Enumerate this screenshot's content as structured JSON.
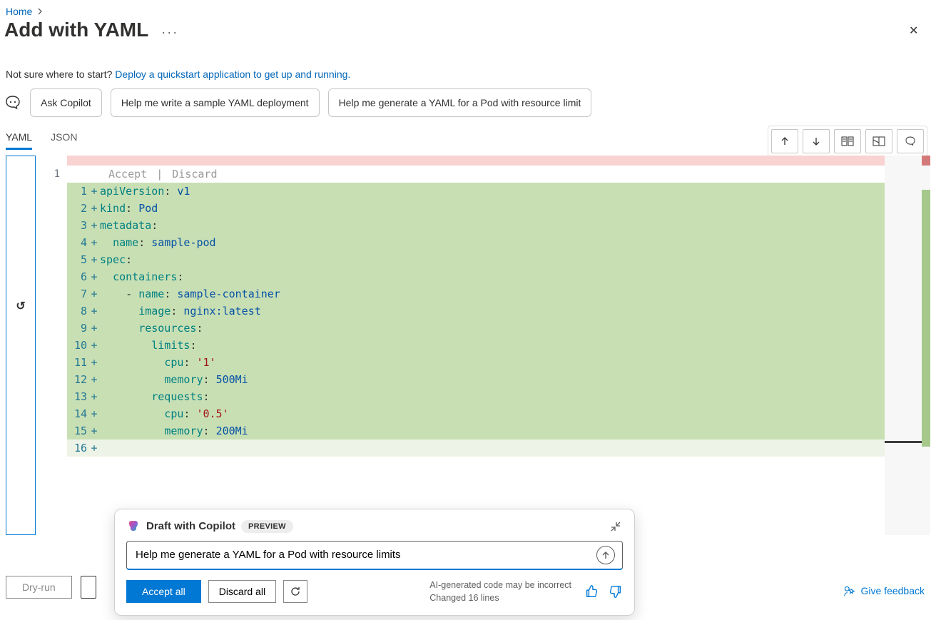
{
  "breadcrumb": {
    "home": "Home"
  },
  "title": "Add with YAML",
  "hint": {
    "lead": "Not sure where to start? ",
    "link": "Deploy a quickstart application to get up and running."
  },
  "suggestions": {
    "ask": "Ask Copilot",
    "s1": "Help me write a sample YAML deployment",
    "s2": "Help me generate a YAML for a Pod with resource limit"
  },
  "tabs": {
    "yaml": "YAML",
    "json": "JSON"
  },
  "editor": {
    "outer_line": "1",
    "accept": "Accept",
    "discard": "Discard",
    "lines": [
      {
        "n": "1",
        "k": "apiVersion",
        "rest": ": ",
        "val": "v1",
        "cls": "v"
      },
      {
        "n": "2",
        "k": "kind",
        "rest": ": ",
        "val": "Pod",
        "cls": "v"
      },
      {
        "n": "3",
        "k": "metadata",
        "rest": ":",
        "val": "",
        "cls": ""
      },
      {
        "n": "4",
        "pre": "  ",
        "k": "name",
        "rest": ": ",
        "val": "sample-pod",
        "cls": "v"
      },
      {
        "n": "5",
        "k": "spec",
        "rest": ":",
        "val": "",
        "cls": ""
      },
      {
        "n": "6",
        "pre": "  ",
        "k": "containers",
        "rest": ":",
        "val": "",
        "cls": ""
      },
      {
        "n": "7",
        "pre": "    - ",
        "k": "name",
        "rest": ": ",
        "val": "sample-container",
        "cls": "v"
      },
      {
        "n": "8",
        "pre": "      ",
        "k": "image",
        "rest": ": ",
        "val": "nginx:latest",
        "cls": "v"
      },
      {
        "n": "9",
        "pre": "      ",
        "k": "resources",
        "rest": ":",
        "val": "",
        "cls": ""
      },
      {
        "n": "10",
        "pre": "        ",
        "k": "limits",
        "rest": ":",
        "val": "",
        "cls": ""
      },
      {
        "n": "11",
        "pre": "          ",
        "k": "cpu",
        "rest": ": ",
        "val": "'1'",
        "cls": "s"
      },
      {
        "n": "12",
        "pre": "          ",
        "k": "memory",
        "rest": ": ",
        "val": "500Mi",
        "cls": "v"
      },
      {
        "n": "13",
        "pre": "        ",
        "k": "requests",
        "rest": ":",
        "val": "",
        "cls": ""
      },
      {
        "n": "14",
        "pre": "          ",
        "k": "cpu",
        "rest": ": ",
        "val": "'0.5'",
        "cls": "s"
      },
      {
        "n": "15",
        "pre": "          ",
        "k": "memory",
        "rest": ": ",
        "val": "200Mi",
        "cls": "v"
      },
      {
        "n": "16",
        "pre": "",
        "k": "",
        "rest": "",
        "val": "",
        "cls": "",
        "last": true
      }
    ]
  },
  "footer": {
    "dryrun": "Dry-run"
  },
  "feedback": "Give feedback",
  "copilot": {
    "title": "Draft with Copilot",
    "badge": "PREVIEW",
    "value": "Help me generate a YAML for a Pod with resource limits",
    "accept": "Accept all",
    "discard": "Discard all",
    "note1": "AI-generated code may be incorrect",
    "note2": "Changed 16 lines"
  }
}
